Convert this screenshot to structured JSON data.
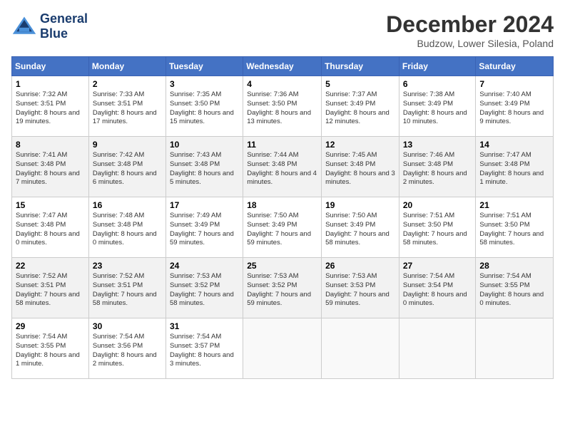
{
  "header": {
    "logo_general": "General",
    "logo_blue": "Blue",
    "month_title": "December 2024",
    "location": "Budzow, Lower Silesia, Poland"
  },
  "weekdays": [
    "Sunday",
    "Monday",
    "Tuesday",
    "Wednesday",
    "Thursday",
    "Friday",
    "Saturday"
  ],
  "weeks": [
    [
      {
        "day": "1",
        "info": "Sunrise: 7:32 AM\nSunset: 3:51 PM\nDaylight: 8 hours and 19 minutes."
      },
      {
        "day": "2",
        "info": "Sunrise: 7:33 AM\nSunset: 3:51 PM\nDaylight: 8 hours and 17 minutes."
      },
      {
        "day": "3",
        "info": "Sunrise: 7:35 AM\nSunset: 3:50 PM\nDaylight: 8 hours and 15 minutes."
      },
      {
        "day": "4",
        "info": "Sunrise: 7:36 AM\nSunset: 3:50 PM\nDaylight: 8 hours and 13 minutes."
      },
      {
        "day": "5",
        "info": "Sunrise: 7:37 AM\nSunset: 3:49 PM\nDaylight: 8 hours and 12 minutes."
      },
      {
        "day": "6",
        "info": "Sunrise: 7:38 AM\nSunset: 3:49 PM\nDaylight: 8 hours and 10 minutes."
      },
      {
        "day": "7",
        "info": "Sunrise: 7:40 AM\nSunset: 3:49 PM\nDaylight: 8 hours and 9 minutes."
      }
    ],
    [
      {
        "day": "8",
        "info": "Sunrise: 7:41 AM\nSunset: 3:48 PM\nDaylight: 8 hours and 7 minutes."
      },
      {
        "day": "9",
        "info": "Sunrise: 7:42 AM\nSunset: 3:48 PM\nDaylight: 8 hours and 6 minutes."
      },
      {
        "day": "10",
        "info": "Sunrise: 7:43 AM\nSunset: 3:48 PM\nDaylight: 8 hours and 5 minutes."
      },
      {
        "day": "11",
        "info": "Sunrise: 7:44 AM\nSunset: 3:48 PM\nDaylight: 8 hours and 4 minutes."
      },
      {
        "day": "12",
        "info": "Sunrise: 7:45 AM\nSunset: 3:48 PM\nDaylight: 8 hours and 3 minutes."
      },
      {
        "day": "13",
        "info": "Sunrise: 7:46 AM\nSunset: 3:48 PM\nDaylight: 8 hours and 2 minutes."
      },
      {
        "day": "14",
        "info": "Sunrise: 7:47 AM\nSunset: 3:48 PM\nDaylight: 8 hours and 1 minute."
      }
    ],
    [
      {
        "day": "15",
        "info": "Sunrise: 7:47 AM\nSunset: 3:48 PM\nDaylight: 8 hours and 0 minutes."
      },
      {
        "day": "16",
        "info": "Sunrise: 7:48 AM\nSunset: 3:48 PM\nDaylight: 8 hours and 0 minutes."
      },
      {
        "day": "17",
        "info": "Sunrise: 7:49 AM\nSunset: 3:49 PM\nDaylight: 7 hours and 59 minutes."
      },
      {
        "day": "18",
        "info": "Sunrise: 7:50 AM\nSunset: 3:49 PM\nDaylight: 7 hours and 59 minutes."
      },
      {
        "day": "19",
        "info": "Sunrise: 7:50 AM\nSunset: 3:49 PM\nDaylight: 7 hours and 58 minutes."
      },
      {
        "day": "20",
        "info": "Sunrise: 7:51 AM\nSunset: 3:50 PM\nDaylight: 7 hours and 58 minutes."
      },
      {
        "day": "21",
        "info": "Sunrise: 7:51 AM\nSunset: 3:50 PM\nDaylight: 7 hours and 58 minutes."
      }
    ],
    [
      {
        "day": "22",
        "info": "Sunrise: 7:52 AM\nSunset: 3:51 PM\nDaylight: 7 hours and 58 minutes."
      },
      {
        "day": "23",
        "info": "Sunrise: 7:52 AM\nSunset: 3:51 PM\nDaylight: 7 hours and 58 minutes."
      },
      {
        "day": "24",
        "info": "Sunrise: 7:53 AM\nSunset: 3:52 PM\nDaylight: 7 hours and 58 minutes."
      },
      {
        "day": "25",
        "info": "Sunrise: 7:53 AM\nSunset: 3:52 PM\nDaylight: 7 hours and 59 minutes."
      },
      {
        "day": "26",
        "info": "Sunrise: 7:53 AM\nSunset: 3:53 PM\nDaylight: 7 hours and 59 minutes."
      },
      {
        "day": "27",
        "info": "Sunrise: 7:54 AM\nSunset: 3:54 PM\nDaylight: 8 hours and 0 minutes."
      },
      {
        "day": "28",
        "info": "Sunrise: 7:54 AM\nSunset: 3:55 PM\nDaylight: 8 hours and 0 minutes."
      }
    ],
    [
      {
        "day": "29",
        "info": "Sunrise: 7:54 AM\nSunset: 3:55 PM\nDaylight: 8 hours and 1 minute."
      },
      {
        "day": "30",
        "info": "Sunrise: 7:54 AM\nSunset: 3:56 PM\nDaylight: 8 hours and 2 minutes."
      },
      {
        "day": "31",
        "info": "Sunrise: 7:54 AM\nSunset: 3:57 PM\nDaylight: 8 hours and 3 minutes."
      },
      null,
      null,
      null,
      null
    ]
  ]
}
